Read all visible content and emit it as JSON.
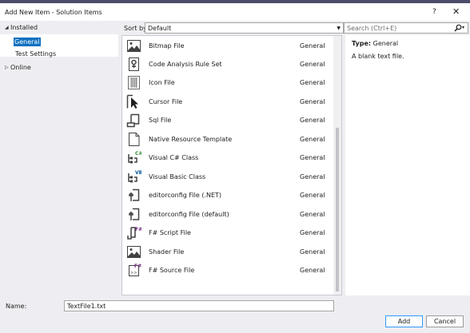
{
  "window": {
    "title": "Add New Item - Solution Items",
    "help_label": "?",
    "close_label": "✕"
  },
  "tree": {
    "installed": "Installed",
    "general": "General",
    "test_settings": "Test Settings",
    "online": "Online",
    "expanded_glyph": "◢",
    "collapsed_glyph": "▷"
  },
  "sort": {
    "label": "Sort by:",
    "value": "Default",
    "arrow": "▼"
  },
  "search": {
    "placeholder": "Search (Ctrl+E)",
    "arrow": "▾"
  },
  "items": [
    {
      "name": "Bitmap File",
      "category": "General",
      "icon": "bitmap-icon"
    },
    {
      "name": "Code Analysis Rule Set",
      "category": "General",
      "icon": "rule-set-icon"
    },
    {
      "name": "Icon File",
      "category": "General",
      "icon": "icon-file-icon"
    },
    {
      "name": "Cursor File",
      "category": "General",
      "icon": "cursor-file-icon"
    },
    {
      "name": "Sql File",
      "category": "General",
      "icon": "sql-file-icon"
    },
    {
      "name": "Native Resource Template",
      "category": "General",
      "icon": "resource-template-icon"
    },
    {
      "name": "Visual C# Class",
      "category": "General",
      "icon": "csharp-class-icon"
    },
    {
      "name": "Visual Basic Class",
      "category": "General",
      "icon": "vb-class-icon"
    },
    {
      "name": "editorconfig File (.NET)",
      "category": "General",
      "icon": "editorconfig-icon"
    },
    {
      "name": "editorconfig File (default)",
      "category": "General",
      "icon": "editorconfig-icon"
    },
    {
      "name": "F# Script File",
      "category": "General",
      "icon": "fsharp-script-icon"
    },
    {
      "name": "Shader File",
      "category": "General",
      "icon": "shader-file-icon"
    },
    {
      "name": "F# Source File",
      "category": "General",
      "icon": "fsharp-source-icon"
    }
  ],
  "details": {
    "type_label": "Type:",
    "type_value": "General",
    "description": "A blank text file."
  },
  "name_field": {
    "label": "Name:",
    "value": "TextFile1.txt"
  },
  "buttons": {
    "add": "Add",
    "cancel": "Cancel"
  },
  "colors": {
    "selection": "#0e70c0",
    "csharp_badge": "#388a34",
    "vb_badge": "#00539c",
    "fsharp_badge": "#68217a"
  }
}
